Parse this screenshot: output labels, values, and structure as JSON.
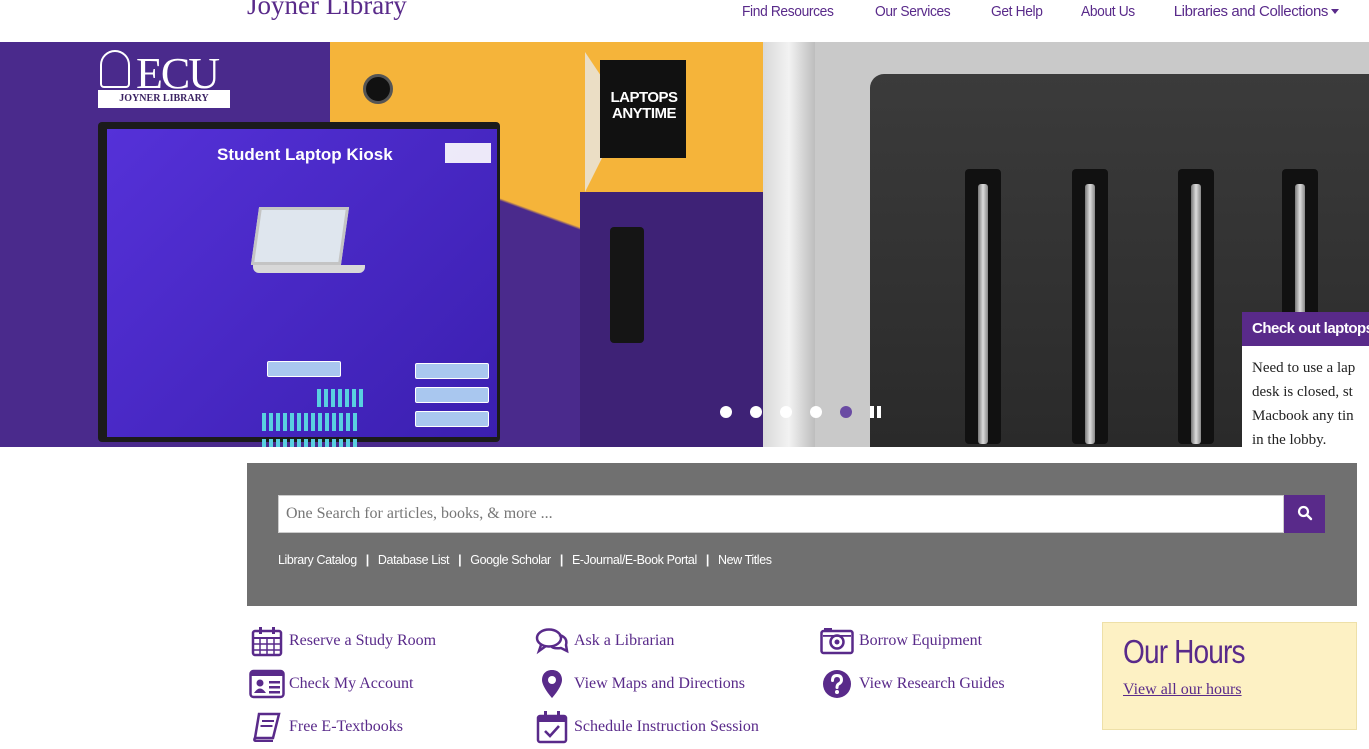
{
  "header": {
    "brand": "Joyner Library",
    "nav": [
      {
        "label": "Find Resources"
      },
      {
        "label": "Our Services"
      },
      {
        "label": "Get Help"
      },
      {
        "label": "About Us"
      },
      {
        "label": "Libraries and Collections",
        "has_dropdown": true
      }
    ]
  },
  "hero": {
    "logo_text": "ECU",
    "logo_subtext": "JOYNER LIBRARY",
    "kiosk_title": "Student Laptop Kiosk",
    "sign_text": "LAPTOPS ANYTIME",
    "carousel": {
      "slide_count": 5,
      "active_index": 4
    },
    "caption": {
      "title": "Check out laptops a",
      "body_lines": [
        "Need to use a lap",
        "desk is closed, st",
        "Macbook any tin",
        "in the lobby."
      ]
    }
  },
  "search": {
    "placeholder": "One Search for articles, books, & more ...",
    "button_icon": "search-icon",
    "links": [
      "Library Catalog",
      "Database List",
      "Google Scholar",
      "E-Journal/E-Book Portal",
      "New Titles"
    ]
  },
  "quick_links": [
    {
      "label": "Reserve a Study Room",
      "icon": "calendar-grid-icon"
    },
    {
      "label": "Check My Account",
      "icon": "id-card-icon"
    },
    {
      "label": "Free E-Textbooks",
      "icon": "book-icon"
    },
    {
      "label": "Ask a Librarian",
      "icon": "chat-bubbles-icon"
    },
    {
      "label": "View Maps and Directions",
      "icon": "map-pin-icon"
    },
    {
      "label": "Schedule Instruction Session",
      "icon": "calendar-check-icon"
    },
    {
      "label": "Borrow Equipment",
      "icon": "camera-icon"
    },
    {
      "label": "View Research Guides",
      "icon": "question-circle-icon"
    }
  ],
  "hours": {
    "title": "Our Hours",
    "link": "View all our hours"
  },
  "colors": {
    "brand_purple": "#592a8a",
    "panel_gray": "#707070",
    "hours_bg": "#fdf1c4"
  }
}
